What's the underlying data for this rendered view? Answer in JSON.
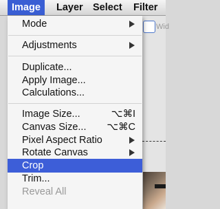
{
  "menubar": {
    "items": [
      {
        "label": "Image"
      },
      {
        "label": "Layer"
      },
      {
        "label": "Select"
      },
      {
        "label": "Filter"
      }
    ]
  },
  "background": {
    "field_text": "Wid"
  },
  "menu": {
    "items": [
      {
        "label": "Mode",
        "submenu": true
      },
      {
        "label": "Adjustments",
        "submenu": true
      },
      {
        "label": "Duplicate..."
      },
      {
        "label": "Apply Image..."
      },
      {
        "label": "Calculations..."
      },
      {
        "label": "Image Size...",
        "shortcut": "⌥⌘I"
      },
      {
        "label": "Canvas Size...",
        "shortcut": "⌥⌘C"
      },
      {
        "label": "Pixel Aspect Ratio",
        "submenu": true
      },
      {
        "label": "Rotate Canvas",
        "submenu": true
      },
      {
        "label": "Crop",
        "selected": true
      },
      {
        "label": "Trim..."
      },
      {
        "label": "Reveal All",
        "disabled": true
      }
    ]
  },
  "colors": {
    "highlight": "#3d5ed8",
    "menubar_active": "#3a5fd4",
    "disabled_text": "#999999"
  }
}
